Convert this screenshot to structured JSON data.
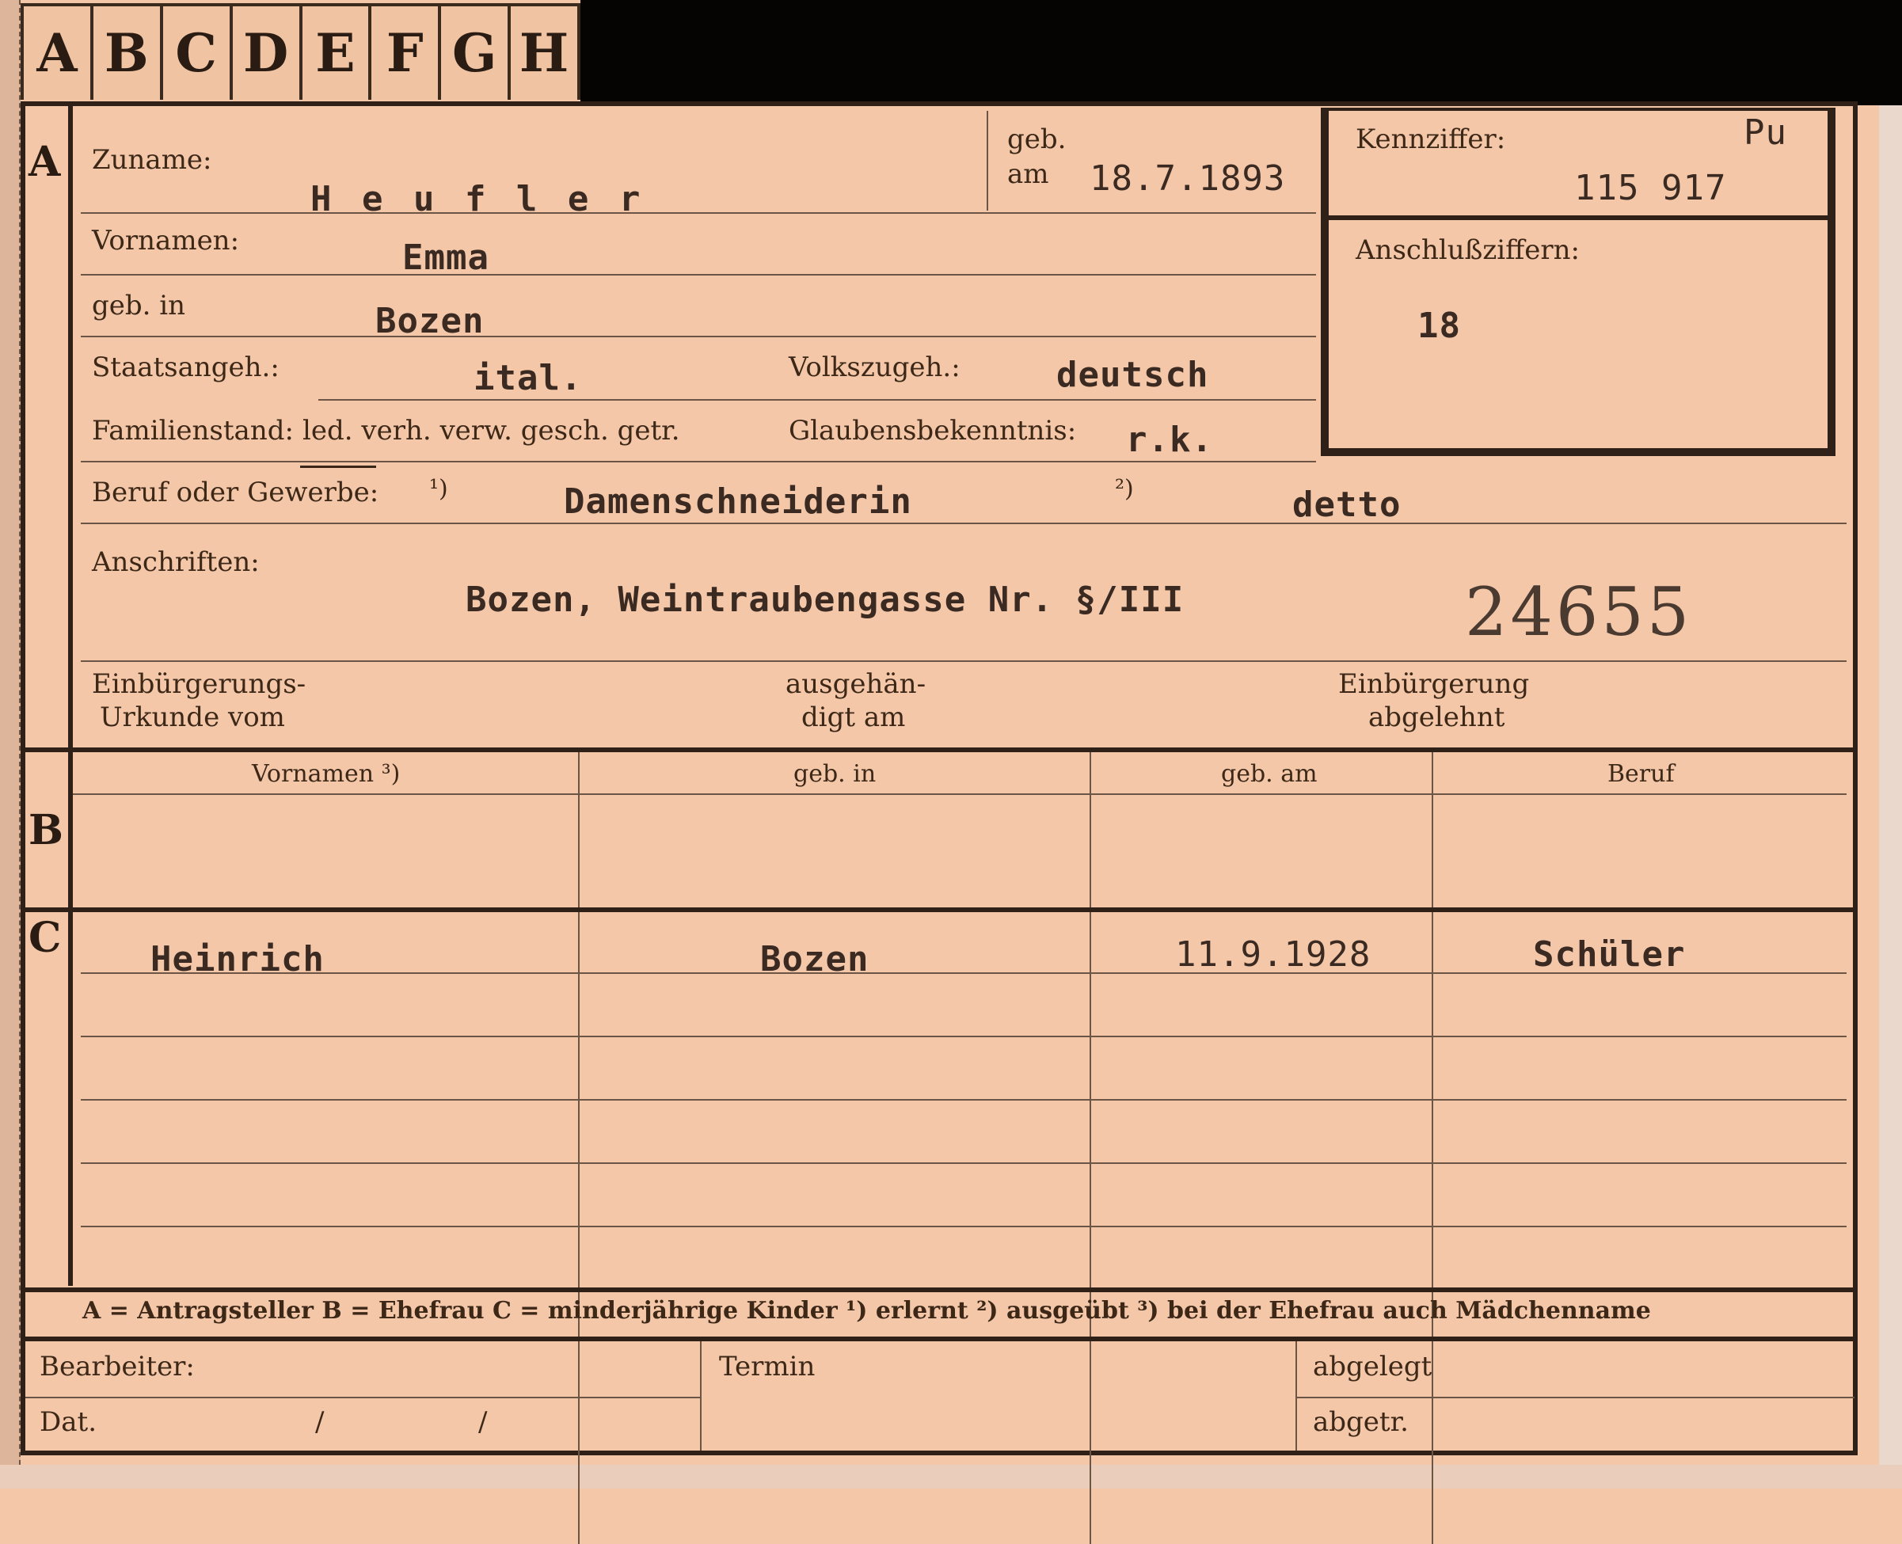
{
  "tabs": [
    "A",
    "B",
    "C",
    "D",
    "E",
    "F",
    "G",
    "H"
  ],
  "sections": {
    "a": "A",
    "b": "B",
    "c": "C"
  },
  "labels": {
    "zuname": "Zuname:",
    "geb": "geb.",
    "am": "am",
    "kennziffer": "Kennziffer:",
    "vornamen": "Vornamen:",
    "anschlussziffern": "Anschlußziffern:",
    "geb_in": "geb. in",
    "staatsangeh": "Staatsangeh.:",
    "volkszugeh": "Volkszugeh.:",
    "familienstand": "Familienstand:",
    "familienstand_options": "led. verh. verw. gesch. getr.",
    "glaubensbekenntnis": "Glaubensbekenntnis:",
    "beruf": "Beruf oder Gewerbe:",
    "fn1": "¹)",
    "fn2": "²)",
    "anschriften": "Anschriften:",
    "einbuergerungs_line1": "Einbürgerungs-",
    "einbuergerungs_line2": "Urkunde vom",
    "ausgehaen_line1": "ausgehän-",
    "ausgehaen_line2": "digt am",
    "einbuergerung_line1": "Einbürgerung",
    "einbuergerung_line2": "abgelehnt",
    "col_vornamen": "Vornamen ³)",
    "col_geb_in": "geb. in",
    "col_geb_am": "geb. am",
    "col_beruf": "Beruf",
    "legend": "A = Antragsteller   B = Ehefrau   C = minderjährige Kinder   ¹) erlernt   ²) ausgeübt   ³) bei der Ehefrau auch Mädchenname",
    "bearbeiter": "Bearbeiter:",
    "termin": "Termin",
    "abgelegt": "abgelegt",
    "dat": "Dat.",
    "slash1": "/",
    "slash2": "/",
    "abgetr": "abgetr."
  },
  "values": {
    "zuname": "H e u f l e r",
    "geb_am": "18.7.1893",
    "kennziffer_code": "Pu",
    "kennziffer": "115 917",
    "vornamen": "Emma",
    "anschlussziffern": "18",
    "geb_in": "Bozen",
    "staatsangeh": "ital.",
    "volkszugeh": "deutsch",
    "glaubensbekenntnis": "r.k.",
    "beruf_erlernt": "Damenschneiderin",
    "beruf_ausgeuebt": "detto",
    "anschrift": "Bozen, Weintraubengasse Nr. §/III",
    "stamp_number": "24655"
  },
  "children": [
    {
      "vornamen": "Heinrich",
      "geb_in": "Bozen",
      "geb_am": "11.9.1928",
      "beruf": "Schüler"
    }
  ]
}
